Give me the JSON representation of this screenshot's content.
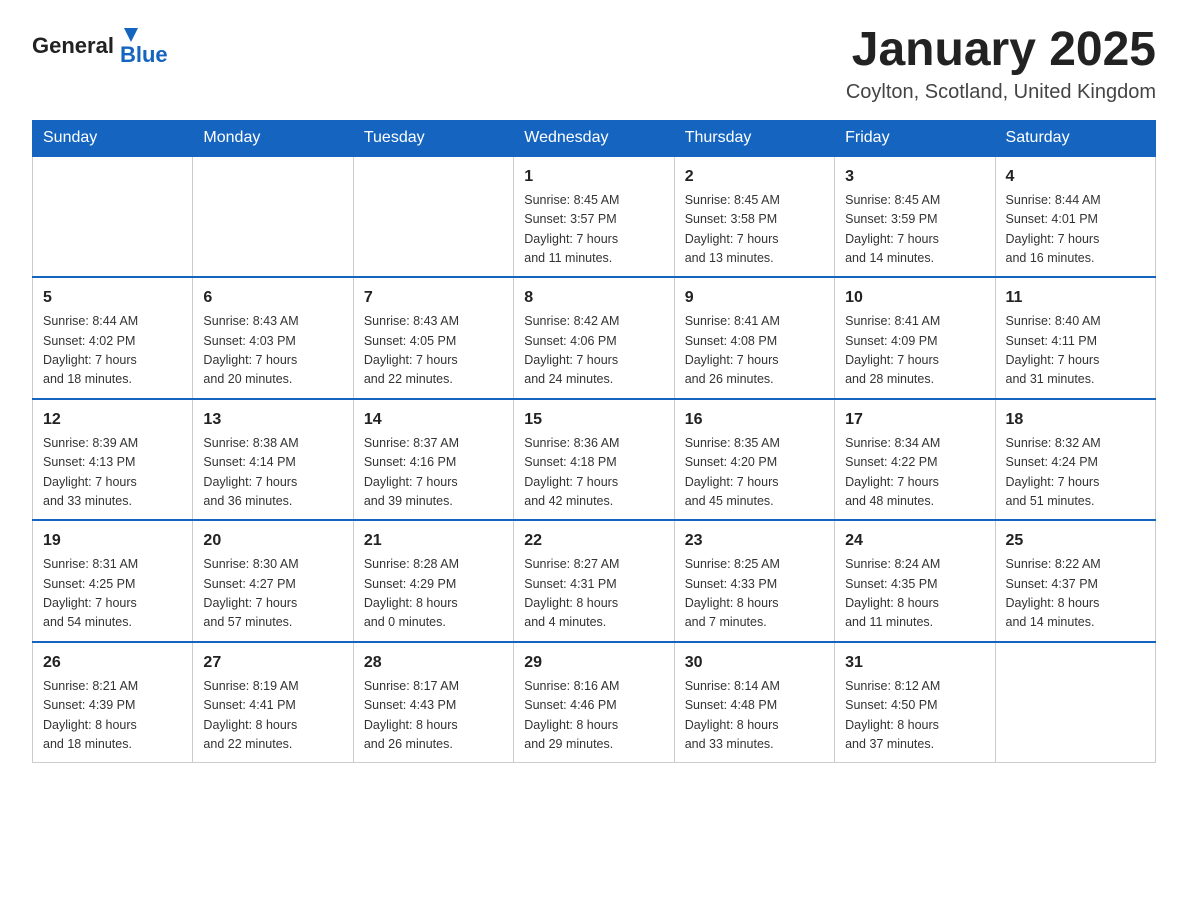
{
  "header": {
    "logo_general": "General",
    "logo_blue": "Blue",
    "month_title": "January 2025",
    "location": "Coylton, Scotland, United Kingdom"
  },
  "weekdays": [
    "Sunday",
    "Monday",
    "Tuesday",
    "Wednesday",
    "Thursday",
    "Friday",
    "Saturday"
  ],
  "weeks": [
    [
      {
        "day": "",
        "info": ""
      },
      {
        "day": "",
        "info": ""
      },
      {
        "day": "",
        "info": ""
      },
      {
        "day": "1",
        "info": "Sunrise: 8:45 AM\nSunset: 3:57 PM\nDaylight: 7 hours\nand 11 minutes."
      },
      {
        "day": "2",
        "info": "Sunrise: 8:45 AM\nSunset: 3:58 PM\nDaylight: 7 hours\nand 13 minutes."
      },
      {
        "day": "3",
        "info": "Sunrise: 8:45 AM\nSunset: 3:59 PM\nDaylight: 7 hours\nand 14 minutes."
      },
      {
        "day": "4",
        "info": "Sunrise: 8:44 AM\nSunset: 4:01 PM\nDaylight: 7 hours\nand 16 minutes."
      }
    ],
    [
      {
        "day": "5",
        "info": "Sunrise: 8:44 AM\nSunset: 4:02 PM\nDaylight: 7 hours\nand 18 minutes."
      },
      {
        "day": "6",
        "info": "Sunrise: 8:43 AM\nSunset: 4:03 PM\nDaylight: 7 hours\nand 20 minutes."
      },
      {
        "day": "7",
        "info": "Sunrise: 8:43 AM\nSunset: 4:05 PM\nDaylight: 7 hours\nand 22 minutes."
      },
      {
        "day": "8",
        "info": "Sunrise: 8:42 AM\nSunset: 4:06 PM\nDaylight: 7 hours\nand 24 minutes."
      },
      {
        "day": "9",
        "info": "Sunrise: 8:41 AM\nSunset: 4:08 PM\nDaylight: 7 hours\nand 26 minutes."
      },
      {
        "day": "10",
        "info": "Sunrise: 8:41 AM\nSunset: 4:09 PM\nDaylight: 7 hours\nand 28 minutes."
      },
      {
        "day": "11",
        "info": "Sunrise: 8:40 AM\nSunset: 4:11 PM\nDaylight: 7 hours\nand 31 minutes."
      }
    ],
    [
      {
        "day": "12",
        "info": "Sunrise: 8:39 AM\nSunset: 4:13 PM\nDaylight: 7 hours\nand 33 minutes."
      },
      {
        "day": "13",
        "info": "Sunrise: 8:38 AM\nSunset: 4:14 PM\nDaylight: 7 hours\nand 36 minutes."
      },
      {
        "day": "14",
        "info": "Sunrise: 8:37 AM\nSunset: 4:16 PM\nDaylight: 7 hours\nand 39 minutes."
      },
      {
        "day": "15",
        "info": "Sunrise: 8:36 AM\nSunset: 4:18 PM\nDaylight: 7 hours\nand 42 minutes."
      },
      {
        "day": "16",
        "info": "Sunrise: 8:35 AM\nSunset: 4:20 PM\nDaylight: 7 hours\nand 45 minutes."
      },
      {
        "day": "17",
        "info": "Sunrise: 8:34 AM\nSunset: 4:22 PM\nDaylight: 7 hours\nand 48 minutes."
      },
      {
        "day": "18",
        "info": "Sunrise: 8:32 AM\nSunset: 4:24 PM\nDaylight: 7 hours\nand 51 minutes."
      }
    ],
    [
      {
        "day": "19",
        "info": "Sunrise: 8:31 AM\nSunset: 4:25 PM\nDaylight: 7 hours\nand 54 minutes."
      },
      {
        "day": "20",
        "info": "Sunrise: 8:30 AM\nSunset: 4:27 PM\nDaylight: 7 hours\nand 57 minutes."
      },
      {
        "day": "21",
        "info": "Sunrise: 8:28 AM\nSunset: 4:29 PM\nDaylight: 8 hours\nand 0 minutes."
      },
      {
        "day": "22",
        "info": "Sunrise: 8:27 AM\nSunset: 4:31 PM\nDaylight: 8 hours\nand 4 minutes."
      },
      {
        "day": "23",
        "info": "Sunrise: 8:25 AM\nSunset: 4:33 PM\nDaylight: 8 hours\nand 7 minutes."
      },
      {
        "day": "24",
        "info": "Sunrise: 8:24 AM\nSunset: 4:35 PM\nDaylight: 8 hours\nand 11 minutes."
      },
      {
        "day": "25",
        "info": "Sunrise: 8:22 AM\nSunset: 4:37 PM\nDaylight: 8 hours\nand 14 minutes."
      }
    ],
    [
      {
        "day": "26",
        "info": "Sunrise: 8:21 AM\nSunset: 4:39 PM\nDaylight: 8 hours\nand 18 minutes."
      },
      {
        "day": "27",
        "info": "Sunrise: 8:19 AM\nSunset: 4:41 PM\nDaylight: 8 hours\nand 22 minutes."
      },
      {
        "day": "28",
        "info": "Sunrise: 8:17 AM\nSunset: 4:43 PM\nDaylight: 8 hours\nand 26 minutes."
      },
      {
        "day": "29",
        "info": "Sunrise: 8:16 AM\nSunset: 4:46 PM\nDaylight: 8 hours\nand 29 minutes."
      },
      {
        "day": "30",
        "info": "Sunrise: 8:14 AM\nSunset: 4:48 PM\nDaylight: 8 hours\nand 33 minutes."
      },
      {
        "day": "31",
        "info": "Sunrise: 8:12 AM\nSunset: 4:50 PM\nDaylight: 8 hours\nand 37 minutes."
      },
      {
        "day": "",
        "info": ""
      }
    ]
  ]
}
